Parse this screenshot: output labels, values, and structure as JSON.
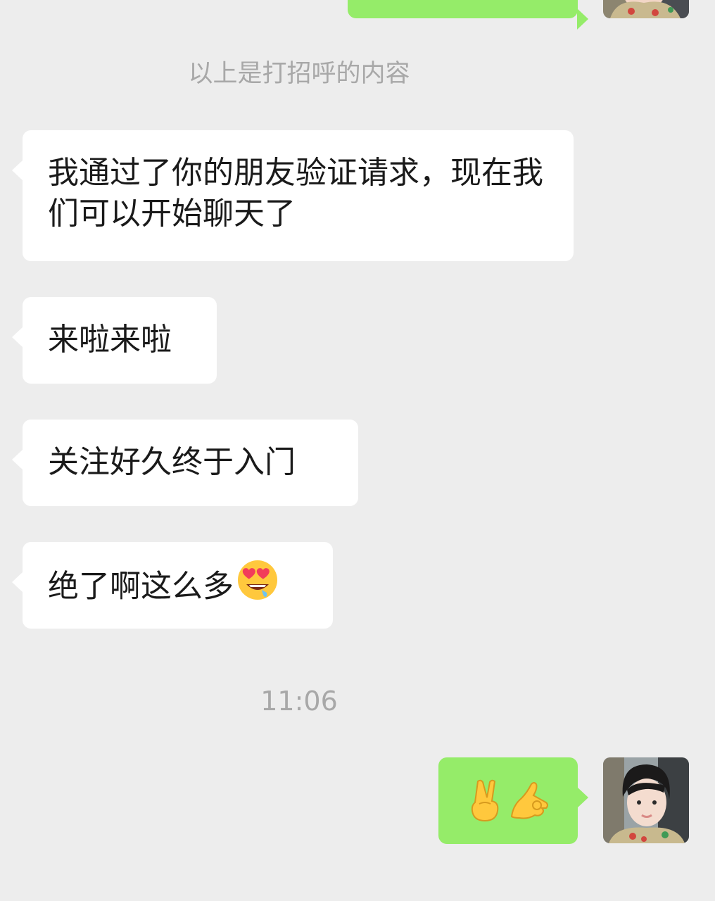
{
  "system_note": "以上是打招呼的内容",
  "timestamp": "11:06",
  "messages": [
    {
      "side": "incoming",
      "text": "我通过了你的朋友验证请求，现在我们可以开始聊天了"
    },
    {
      "side": "incoming",
      "text": "来啦来啦"
    },
    {
      "side": "incoming",
      "text": "关注好久终于入门"
    },
    {
      "side": "incoming",
      "text": "绝了啊这么多",
      "trailing_emoji": "heart-eyes-drooling-emoji"
    },
    {
      "side": "outgoing",
      "emojis": [
        "victory-hand-emoji",
        "ok-hand-emoji"
      ]
    }
  ],
  "colors": {
    "background": "#ededed",
    "incoming_bubble": "#ffffff",
    "outgoing_bubble": "#95ec69",
    "meta_text": "#a8a8a8"
  }
}
